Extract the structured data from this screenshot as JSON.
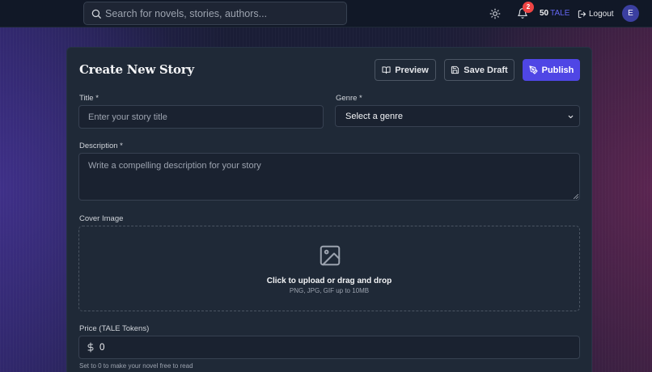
{
  "topbar": {
    "search_placeholder": "Search for novels, stories, authors...",
    "notification_count": "2",
    "balance_amount": "50",
    "balance_unit": "TALE",
    "logout_label": "Logout",
    "avatar_initial": "E"
  },
  "form": {
    "heading": "Create New Story",
    "preview_label": "Preview",
    "save_draft_label": "Save Draft",
    "publish_label": "Publish",
    "title_label": "Title *",
    "title_placeholder": "Enter your story title",
    "title_value": "",
    "genre_label": "Genre *",
    "genre_selected": "Select a genre",
    "description_label": "Description *",
    "description_placeholder": "Write a compelling description for your story",
    "cover_label": "Cover Image",
    "upload_text": "Click to upload or drag and drop",
    "upload_hint": "PNG, JPG, GIF up to 10MB",
    "price_label": "Price (TALE Tokens)",
    "price_value": "0",
    "price_hint": "Set to 0 to make your novel free to read"
  },
  "colors": {
    "accent": "#4f46e5",
    "badge": "#ef4444",
    "card_bg": "#1f2937",
    "topbar_bg": "#111827"
  },
  "icons": [
    "search-icon",
    "sun-icon",
    "bell-icon",
    "logout-icon",
    "book-open-icon",
    "save-icon",
    "pen-tool-icon",
    "chevron-down-icon",
    "image-icon",
    "dollar-icon"
  ]
}
